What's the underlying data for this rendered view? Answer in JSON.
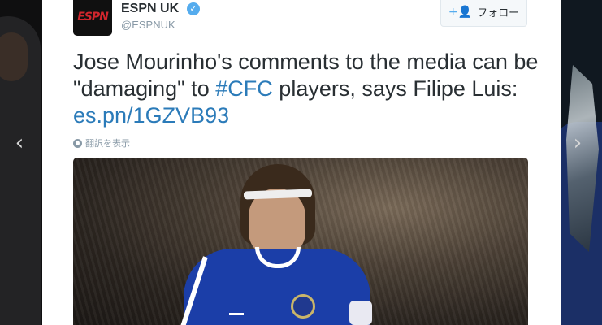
{
  "account": {
    "avatar_text": "ESPN",
    "display_name": "ESPN UK",
    "verified_glyph": "✓",
    "handle": "@ESPNUK"
  },
  "follow_button": {
    "icon": "add-user-icon",
    "icon_glyph": "+👤",
    "label": "フォロー"
  },
  "tweet": {
    "text_part1": "Jose Mourinho's comments to the media can be \"damaging\" to ",
    "hashtag": "#CFC",
    "text_part2": " players, says Filipe Luis: ",
    "link": "es.pn/1GZVB93"
  },
  "translate": {
    "icon": "globe-icon",
    "label": "翻訳を表示"
  },
  "navigation": {
    "prev_glyph": "‹",
    "next_glyph": "›"
  },
  "colors": {
    "link": "#2b7bb9",
    "verified": "#55acee",
    "text": "#292f33",
    "muted": "#8899a6",
    "brand_red": "#d0262d"
  }
}
